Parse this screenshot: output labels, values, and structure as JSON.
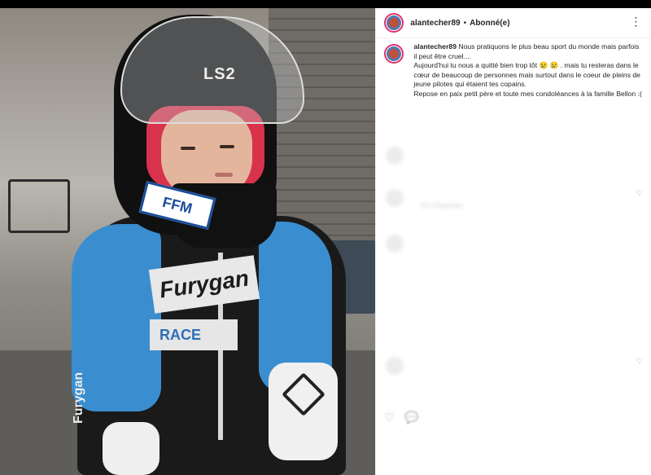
{
  "header": {
    "username": "alantecher89",
    "separator": "•",
    "follow_status": "Abonné(e)",
    "more_icon": "⋮"
  },
  "caption": {
    "username": "alantecher89",
    "text": "Nous pratiquons le plus beau sport du monde mais parfois il peut être cruel....\nAujourd'hui tu nous a quitté bien trop tôt 😢 😢 . mais tu resteras dans le cœur de beaucoup de personnes mais surtout dans le coeur de pleins de jeune pilotes qui étaient tes copains.\nRepose en paix petit père et toute mes condoléances à la famille Bellon :("
  },
  "photo": {
    "helmet_brand": "LS2",
    "helmet_sticker": "FFM",
    "suit_brand": "Furygan",
    "chest_badge": "RACE",
    "sleeve_text": "Furygan"
  },
  "comments_blurred": [
    {
      "text": "",
      "has_like": false
    },
    {
      "text": "",
      "has_like": true
    },
    {
      "text": "16 h   Répondre",
      "has_like": false
    },
    {
      "text": "",
      "has_like": false
    },
    {
      "text": "",
      "has_like": true
    }
  ],
  "icons": {
    "heart": "♡",
    "comment": "💬",
    "more": "⋮"
  },
  "colors": {
    "story_ring": "#e1306c",
    "text": "#262626",
    "muted": "#8e8e8e",
    "suit_blue": "#3a8ed0"
  }
}
